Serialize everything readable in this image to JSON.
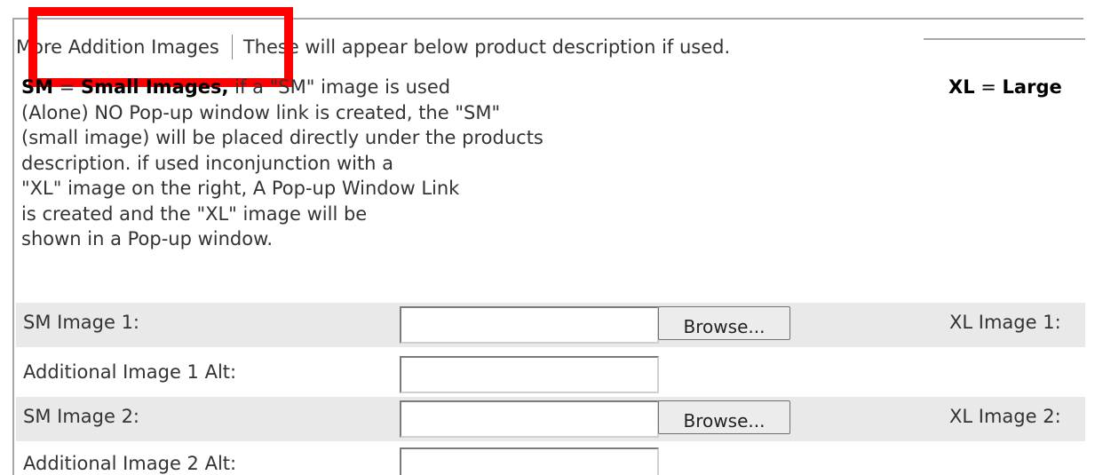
{
  "fieldset": {
    "legend_title": "More Addition Images",
    "legend_note": "These will appear below product description if used."
  },
  "description": {
    "sm_abbrev": "SM",
    "sm_eq": " = ",
    "sm_title": "Small Images,",
    "sm_line1_rest": " if a \"SM\" image is used",
    "lines": [
      "(Alone) NO Pop-up window link is created, the \"SM\"",
      "(small image) will be placed directly under the products",
      "description. if used inconjunction with a",
      "\"XL\" image on the right, A Pop-up Window Link",
      "is created and the \"XL\" image will be",
      "shown in a Pop-up window."
    ],
    "xl_abbrev": "XL",
    "xl_eq": " = ",
    "xl_title_partial": "Large"
  },
  "rows": [
    {
      "label": "SM Image 1:",
      "value": "",
      "browse_label": "Browse...",
      "right_label": "XL Image 1:"
    },
    {
      "label": "Additional Image 1 Alt:",
      "value": ""
    },
    {
      "label": "SM Image 2:",
      "value": "",
      "browse_label": "Browse...",
      "right_label": "XL Image 2:"
    },
    {
      "label": "Additional Image 2 Alt:",
      "value": ""
    }
  ],
  "colors": {
    "highlight": "#ff0000",
    "row_shade": "#e9e9e9",
    "border": "#a8a8a8"
  }
}
